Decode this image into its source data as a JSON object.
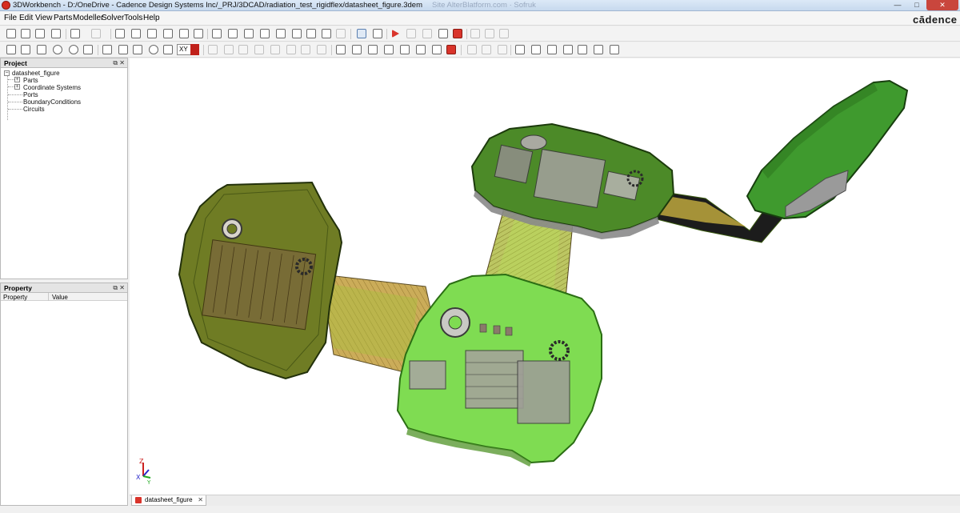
{
  "window": {
    "title": "3DWorkbench - D:/OneDrive - Cadence Design Systems Inc/_PRJ/3DCAD/radiation_test_rigidflex/datasheet_figure.3dem",
    "faded_text": "Site  AlterBlatform.com  ·  Sofruk",
    "min": "—",
    "max": "□",
    "close": "✕"
  },
  "brand": "cādence",
  "menu": [
    "File",
    "Edit",
    "View",
    "Parts",
    "Modeller",
    "Solver",
    "Tools",
    "Help"
  ],
  "toolbar": {
    "plane_combo": "XY"
  },
  "project_panel": {
    "title": "Project",
    "buttons": "⧉ ✕",
    "tree": {
      "root": "datasheet_figure",
      "children": [
        "Parts",
        "Coordinate Systems",
        "Ports",
        "BoundaryConditions",
        "Circuits"
      ],
      "expand": "+",
      "collapse": "−"
    }
  },
  "property_panel": {
    "title": "Property",
    "buttons": "⧉ ✕",
    "columns": [
      "Property",
      "Value"
    ]
  },
  "viewport": {
    "triad": {
      "z": "Z",
      "x": "X",
      "y": "Y"
    },
    "colors": {
      "rigid_dark": "#5e7a1c",
      "rigid_light": "#7fdc52",
      "flex": "#c9a54a",
      "background": "#ffffff"
    }
  },
  "doc_tabs": [
    {
      "label": "datasheet_figure",
      "close": "✕"
    }
  ]
}
